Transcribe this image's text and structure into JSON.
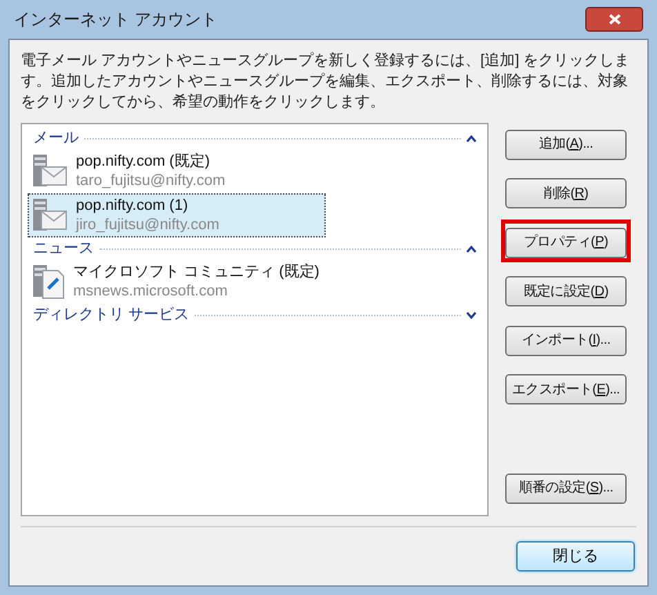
{
  "window": {
    "title": "インターネット アカウント"
  },
  "description": "電子メール アカウントやニュースグループを新しく登録するには、[追加] をクリックします。追加したアカウントやニュースグループを編集、エクスポート、削除するには、対象をクリックしてから、希望の動作をクリックします。",
  "groups": [
    {
      "label": "メール",
      "expanded": true,
      "accounts": [
        {
          "kind": "mail",
          "name": "pop.nifty.com (既定)",
          "address": "taro_fujitsu@nifty.com",
          "selected": false
        },
        {
          "kind": "mail",
          "name": "pop.nifty.com (1)",
          "address": "jiro_fujitsu@nifty.com",
          "selected": true
        }
      ]
    },
    {
      "label": "ニュース",
      "expanded": true,
      "accounts": [
        {
          "kind": "news",
          "name": "マイクロソフト コミュニティ (既定)",
          "address": "msnews.microsoft.com",
          "selected": false
        }
      ]
    },
    {
      "label": "ディレクトリ サービス",
      "expanded": false
    }
  ],
  "buttons": [
    {
      "before": "追加(",
      "key": "A",
      "after": ")...",
      "highlighted": false
    },
    {
      "before": "削除(",
      "key": "R",
      "after": ")",
      "highlighted": false
    },
    {
      "before": "プロパティ(",
      "key": "P",
      "after": ")",
      "highlighted": true
    },
    {
      "before": "既定に設定(",
      "key": "D",
      "after": ")",
      "highlighted": false
    },
    {
      "before": "インポート(",
      "key": "I",
      "after": ")...",
      "highlighted": false
    },
    {
      "before": "エクスポート(",
      "key": "E",
      "after": ")...",
      "highlighted": false
    },
    {
      "before": "順番の設定(",
      "key": "S",
      "after": ")...",
      "highlighted": false
    }
  ],
  "close_button": {
    "label": "閉じる",
    "default": true
  }
}
